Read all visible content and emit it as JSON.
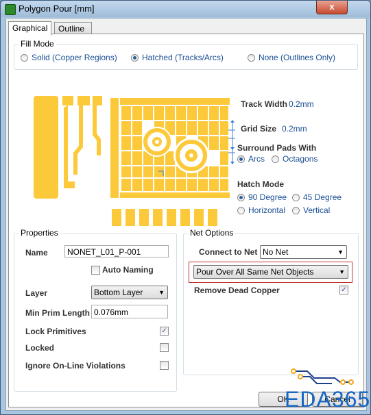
{
  "window": {
    "title": "Polygon Pour [mm]",
    "close_glyph": "x"
  },
  "tabs": [
    {
      "label": "Graphical"
    },
    {
      "label": "Outline Vertices"
    }
  ],
  "fill_mode": {
    "title": "Fill Mode",
    "options": [
      {
        "label": "Solid (Copper Regions)",
        "selected": false
      },
      {
        "label": "Hatched (Tracks/Arcs)",
        "selected": true
      },
      {
        "label": "None (Outlines Only)",
        "selected": false
      }
    ]
  },
  "diagram": {
    "track_width_label": "Track Width",
    "track_width_value": "0.2mm",
    "grid_size_label": "Grid Size",
    "grid_size_value": "0.2mm",
    "pour_color": "#fcc93a"
  },
  "surround_pads": {
    "title": "Surround Pads With",
    "options": [
      {
        "label": "Arcs",
        "selected": true
      },
      {
        "label": "Octagons",
        "selected": false
      }
    ]
  },
  "hatch_mode": {
    "title": "Hatch Mode",
    "options": [
      {
        "label": "90 Degree",
        "selected": true
      },
      {
        "label": "45 Degree",
        "selected": false
      },
      {
        "label": "Horizontal",
        "selected": false
      },
      {
        "label": "Vertical",
        "selected": false
      }
    ]
  },
  "properties": {
    "title": "Properties",
    "name_label": "Name",
    "name_value": "NONET_L01_P-001",
    "auto_naming_label": "Auto Naming",
    "auto_naming_checked": false,
    "layer_label": "Layer",
    "layer_value": "Bottom Layer",
    "min_prim_label": "Min Prim Length",
    "min_prim_value": "0.076mm",
    "lock_primitives_label": "Lock Primitives",
    "lock_primitives_checked": true,
    "locked_label": "Locked",
    "locked_checked": false,
    "ignore_label": "Ignore On-Line Violations",
    "ignore_checked": false
  },
  "net_options": {
    "title": "Net Options",
    "connect_label": "Connect to Net",
    "connect_value": "No Net",
    "pour_value": "Pour Over All Same Net Objects",
    "remove_dead_label": "Remove Dead Copper",
    "remove_dead_checked": true
  },
  "buttons": {
    "ok": "OK",
    "cancel": "Cancel"
  },
  "watermark": "EDA365"
}
